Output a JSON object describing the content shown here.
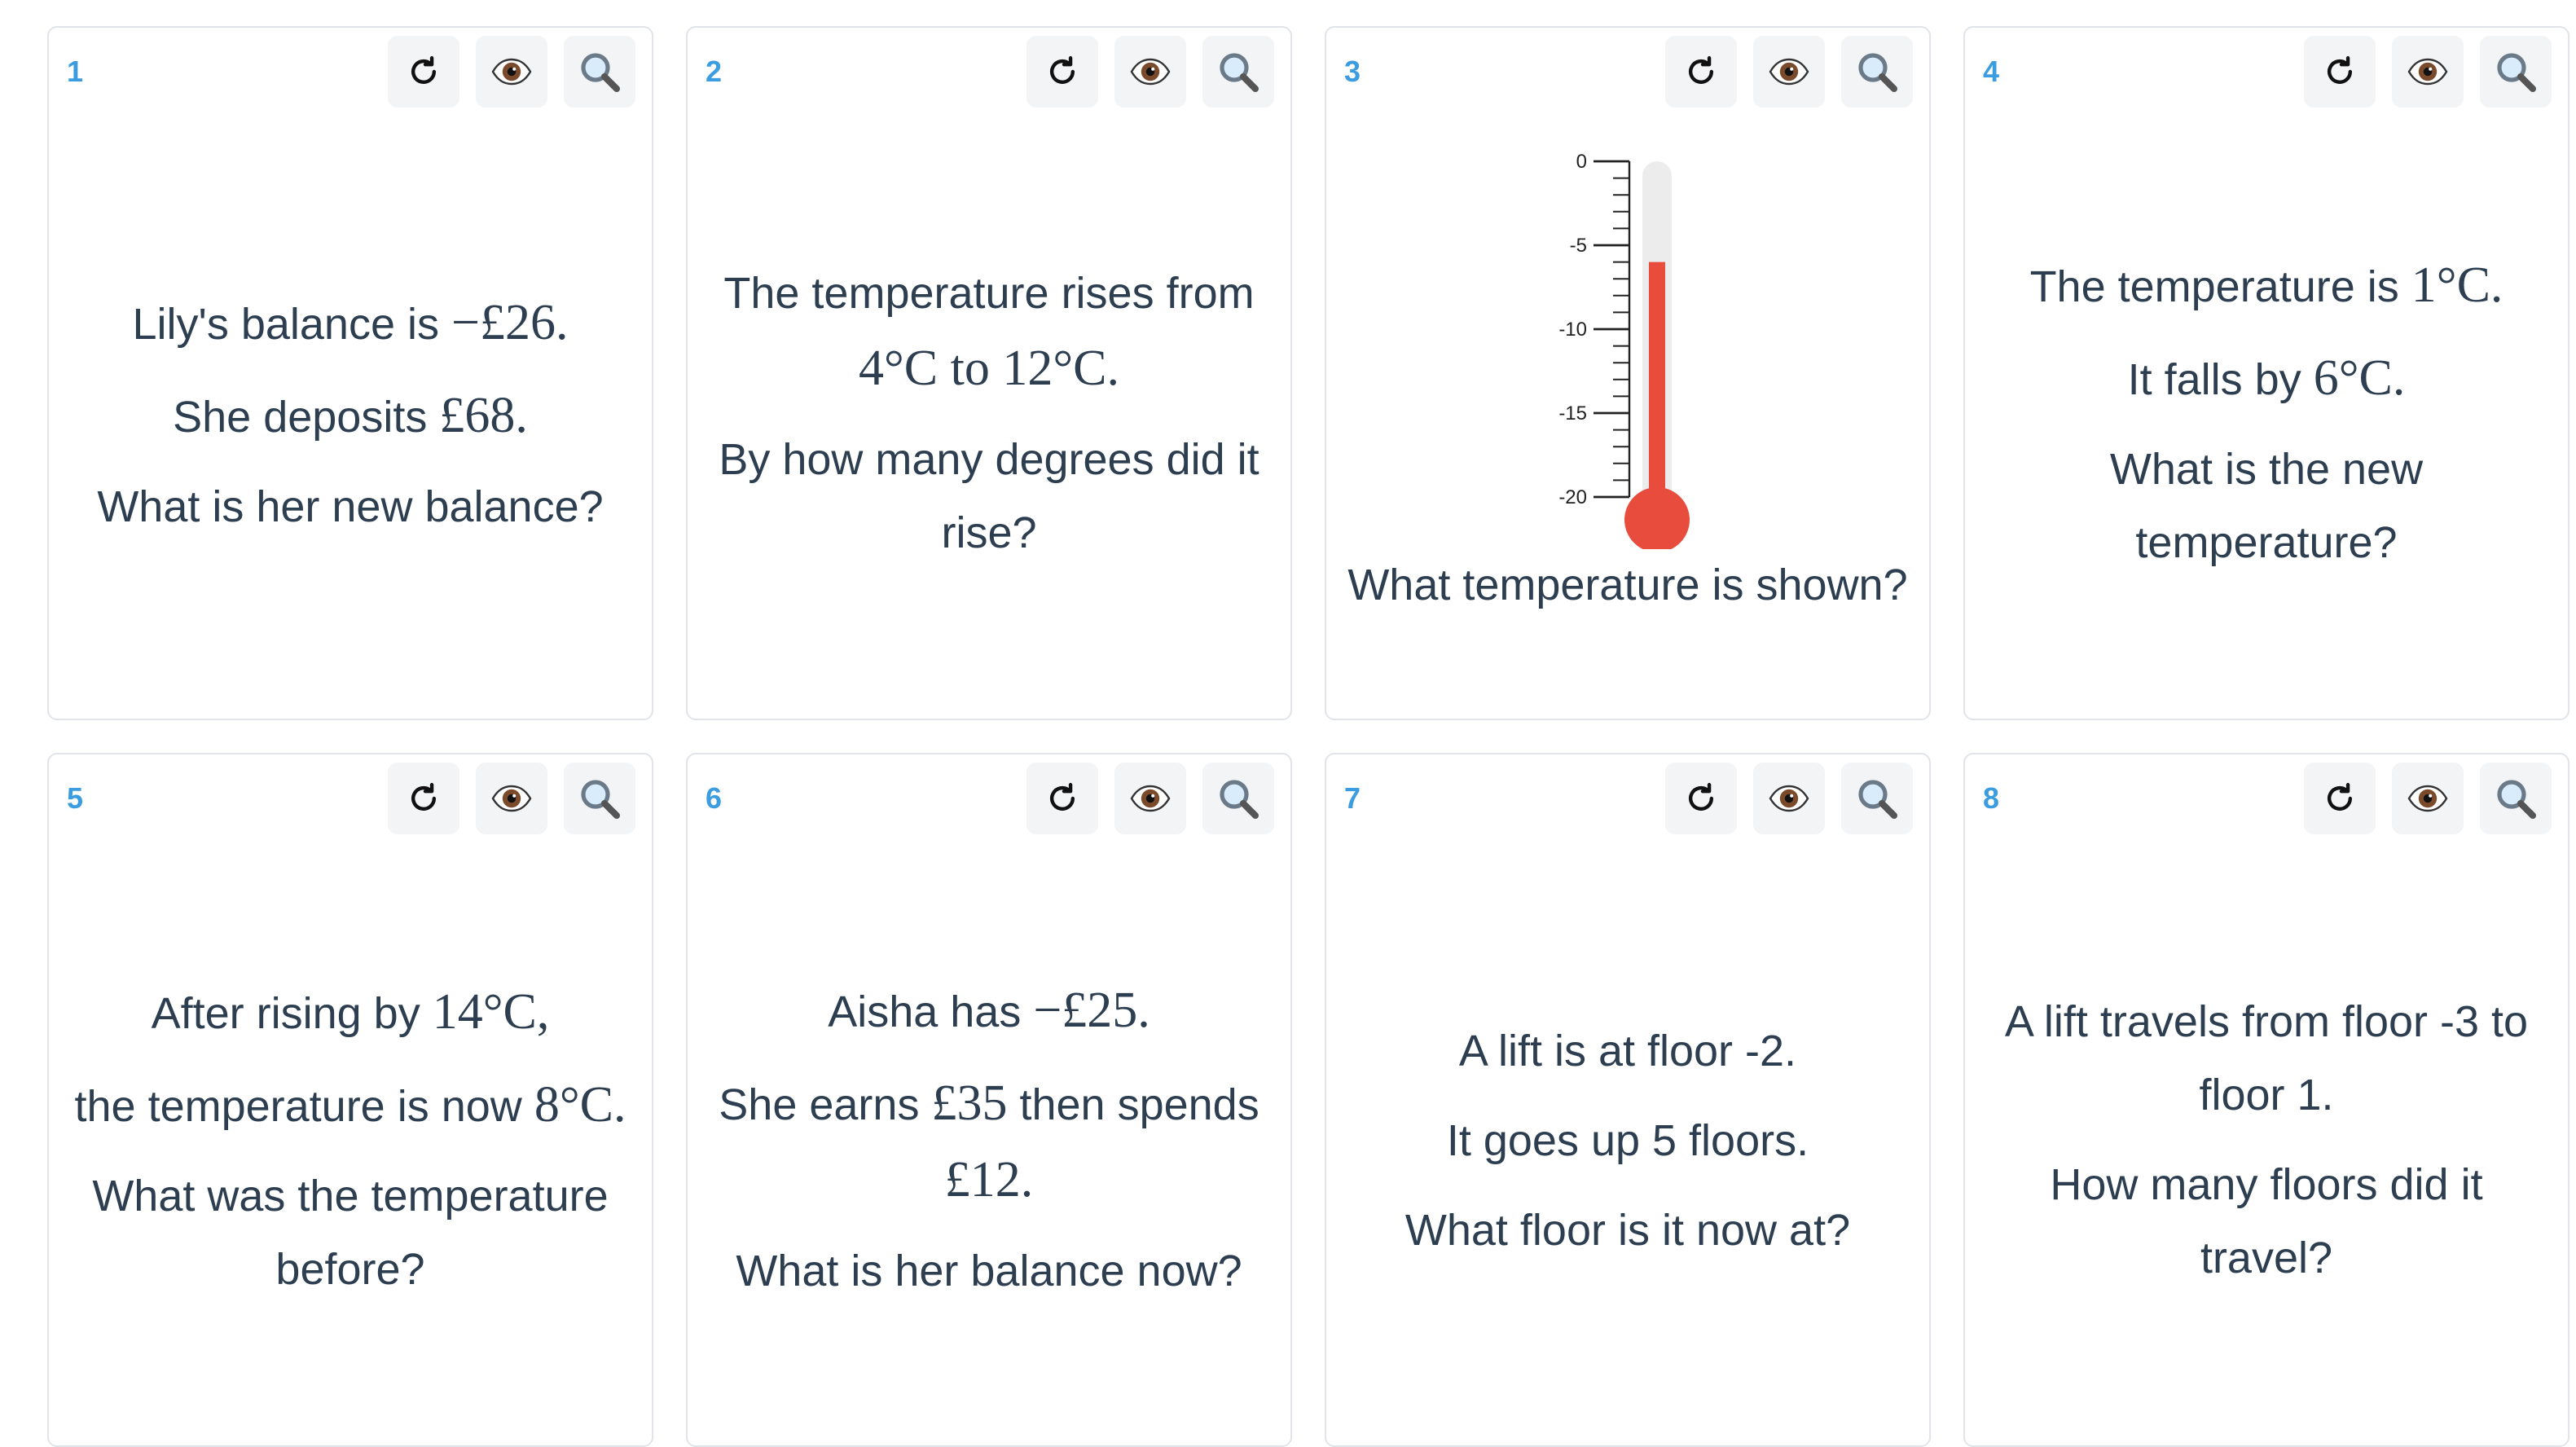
{
  "tools": {
    "regenerate_icon": "refresh-icon",
    "reveal_icon": "eye-icon",
    "zoom_icon": "magnifier-icon"
  },
  "cards": [
    {
      "number": "1",
      "lines": [
        [
          "Lily's balance is ",
          {
            "m": "−£26."
          }
        ],
        [
          "She deposits ",
          {
            "m": "£68."
          }
        ],
        [
          "What is her new balance?"
        ]
      ]
    },
    {
      "number": "2",
      "lines": [
        [
          "The temperature rises from ",
          {
            "m": "4°C to 12°C."
          }
        ],
        [
          "By how many degrees did it rise?"
        ]
      ]
    },
    {
      "number": "3",
      "thermometer": {
        "tick_labels": [
          "0",
          "-5",
          "-10",
          "-15",
          "-20"
        ],
        "reading": -6,
        "range": [
          -20,
          0
        ],
        "fill_color": "#e74c3c"
      },
      "question": "What temperature is shown?"
    },
    {
      "number": "4",
      "lines": [
        [
          "The temperature is ",
          {
            "m": "1°C."
          }
        ],
        [
          "It falls by ",
          {
            "m": "6°C."
          }
        ],
        [
          "What is the new temperature?"
        ]
      ]
    },
    {
      "number": "5",
      "lines": [
        [
          "After rising by ",
          {
            "m": "14°C,"
          }
        ],
        [
          "the temperature is now ",
          {
            "m": "8°C."
          }
        ],
        [
          "What was the temperature before?"
        ]
      ]
    },
    {
      "number": "6",
      "lines": [
        [
          "Aisha has ",
          {
            "m": "−£25."
          }
        ],
        [
          "She earns ",
          {
            "m": "£35"
          },
          " then spends ",
          {
            "m": "£12."
          }
        ],
        [
          "What is her balance now?"
        ]
      ]
    },
    {
      "number": "7",
      "lines": [
        [
          "A lift is at floor -2."
        ],
        [
          "It goes up 5 floors."
        ],
        [
          "What floor is it now at?"
        ]
      ]
    },
    {
      "number": "8",
      "lines": [
        [
          "A lift travels from floor -3 to floor 1."
        ],
        [
          "How many floors did it travel?"
        ]
      ]
    }
  ]
}
